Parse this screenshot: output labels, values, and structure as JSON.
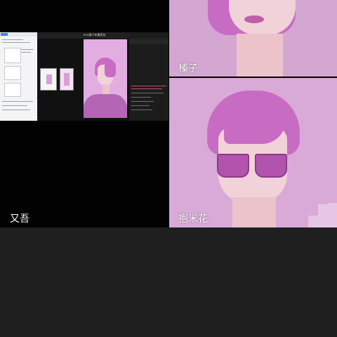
{
  "participants": [
    {
      "name": "又吾",
      "role": "screen-share"
    },
    {
      "name": "榛子",
      "role": "camera"
    },
    {
      "name": "抱米花",
      "role": "camera"
    }
  ],
  "shared_screen": {
    "app_title": "ETA青少年搬家包",
    "colors": {
      "portrait_bg": "#e2aee1",
      "hair": "#c86cc3",
      "skin": "#f0d2d8"
    }
  },
  "colors": {
    "background": "#000000",
    "bottom_area": "#1f1f1f",
    "tile_pink": "#d4a6d2",
    "label": "#ffffff"
  }
}
